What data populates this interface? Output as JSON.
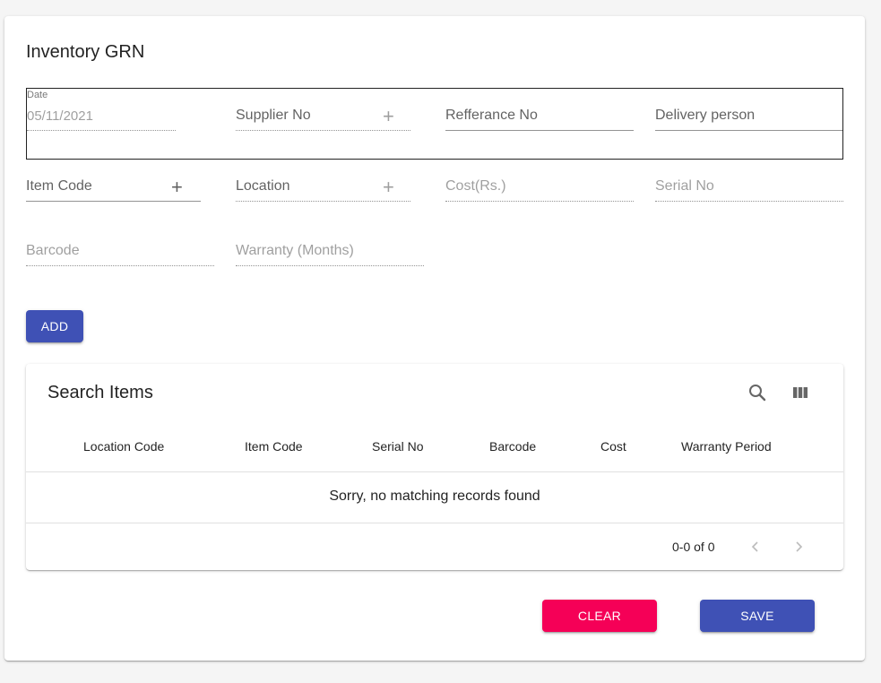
{
  "form": {
    "title": "Inventory GRN",
    "date": {
      "label": "Date",
      "value": "05/11/2021"
    },
    "supplier_no": {
      "label": "Supplier No"
    },
    "reference_no": {
      "label": "Refferance No"
    },
    "delivery_person": {
      "label": "Delivery person"
    },
    "item_code": {
      "label": "Item Code"
    },
    "location": {
      "label": "Location"
    },
    "cost": {
      "label": "Cost(Rs.)"
    },
    "serial_no": {
      "label": "Serial No"
    },
    "barcode": {
      "label": "Barcode"
    },
    "warranty": {
      "label": "Warranty (Months)"
    },
    "add_label": "ADD"
  },
  "table": {
    "title": "Search Items",
    "columns": [
      "Location Code",
      "Item Code",
      "Serial No",
      "Barcode",
      "Cost",
      "Warranty Period"
    ],
    "empty_message": "Sorry, no matching records found",
    "pagination": "0-0 of 0",
    "icons": [
      "search-icon",
      "view-columns-icon",
      "chevron-left-icon",
      "chevron-right-icon"
    ]
  },
  "actions": {
    "clear_label": "CLEAR",
    "save_label": "SAVE"
  },
  "colors": {
    "primary": "#3f51b5",
    "secondary": "#f50057"
  }
}
